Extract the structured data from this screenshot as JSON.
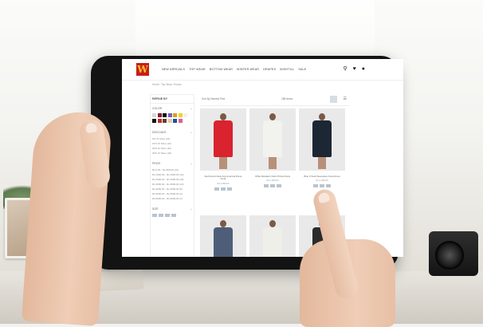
{
  "site": {
    "logo_text": "W",
    "brand_color": "#c71e1d",
    "logo_text_color": "#f4c21b",
    "nav": [
      "NEW ARRIVALS",
      "TOP WEAR",
      "BOTTOM WEAR",
      "WINTER WEAR",
      "DRAPES",
      "WISHTILL",
      "SALE"
    ],
    "icons": [
      "search-icon",
      "wishlist-icon",
      "user-icon"
    ]
  },
  "breadcrumb": "Home / Top Wear / Kurtas",
  "sidebar": {
    "title": "REFINE BY",
    "color_label": "COLOR",
    "swatches": [
      "#d8d8d8",
      "#8a1b2b",
      "#0a0a0a",
      "#7b5cc2",
      "#d6a21c",
      "#f2d11c",
      "#f0f0f0",
      "#111111",
      "#c52b2b",
      "#6b3a2a",
      "#e2c8a0",
      "#1f4fa3",
      "#e05b9c",
      "#ffffff"
    ],
    "discount_label": "DISCOUNT",
    "discount_options": [
      "0% Or More (24)",
      "10% Or More (24)",
      "20% Or More (20)",
      "30% Or More (18)"
    ],
    "price_label": "PRICE",
    "price_options": [
      "Rs.0.00 - Rs.999.00 (10)",
      "Rs.1000.00 - Rs.1999.00 (44)",
      "Rs.2000.00 - Rs.2999.00 (40)",
      "Rs.3000.00 - Rs.3999.00 (22)",
      "Rs.4000.00 - Rs.4999.00 (8)",
      "Rs.5000.00 - Rs.5999.00 (3)",
      "Rs.6000.00 - Rs.6999.00 (1)"
    ],
    "size_label": "SIZE"
  },
  "sortbar": {
    "sort_text": "Sort By   Newest First",
    "count_text": "188 Items"
  },
  "products": [
    {
      "name": "Red Round Neck Asymmetrical Dress Kurta",
      "price": "Rs.1,999.00",
      "dress_color": "#d9232e"
    },
    {
      "name": "White Mandarin Neck Printed Kurta",
      "price": "Rs.1,699.00",
      "dress_color": "#f2f2ee"
    },
    {
      "name": "Blue V Neck Sleeveless Kurta Dress",
      "price": "Rs.1,499.00",
      "dress_color": "#1d2633"
    },
    {
      "name": "",
      "price": "",
      "dress_color": "#4e5e78"
    },
    {
      "name": "",
      "price": "",
      "dress_color": "#efefe9"
    },
    {
      "name": "",
      "price": "",
      "dress_color": "#2b2b2b"
    }
  ]
}
